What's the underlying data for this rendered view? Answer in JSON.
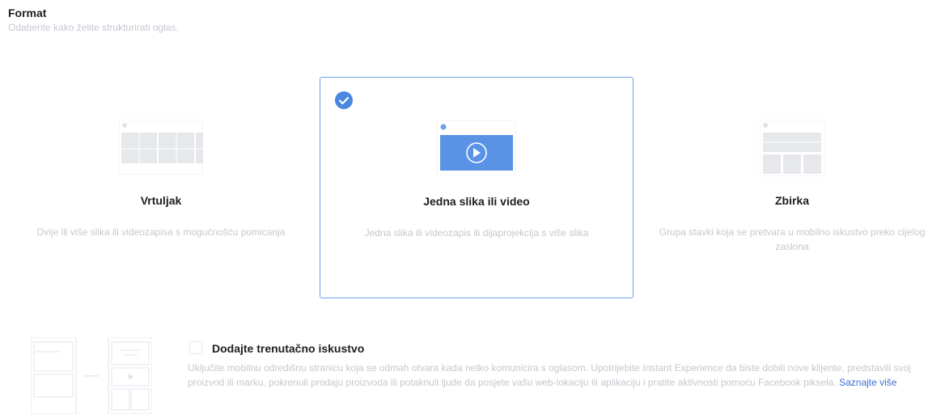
{
  "header": {
    "title": "Format",
    "subtitle": "Odaberite kako želite strukturirati oglas."
  },
  "formats": [
    {
      "name": "Vrtuljak",
      "description": "Dvije ili više slika ili videozapisa s mogućnošću pomicanja",
      "icon": "carousel-icon",
      "selected": false
    },
    {
      "name": "Jedna slika ili video",
      "description": "Jedna slika ili videozapis ili dijaprojekcija s više slika",
      "icon": "single-image-video-icon",
      "selected": true
    },
    {
      "name": "Zbirka",
      "description": "Grupa stavki koja se pretvara u mobilno iskustvo preko cijelog zaslona",
      "icon": "collection-icon",
      "selected": false
    }
  ],
  "instant_experience": {
    "title": "Dodajte trenutačno iskustvo",
    "description": "Uključite mobilnu odredišnu stranicu koja se odmah otvara kada netko komunicira s oglasom. Upotrijebite Instant Experience da biste dobili nove klijente, predstavili svoj proizvod ili marku, pokrenuli prodaju proizvoda ili potaknuli ljude da posjete vašu web-lokaciju ili aplikaciju i pratite aktivnosti pomoću Facebook piksela.",
    "link_label": "Saznajte više",
    "checked": false
  },
  "colors": {
    "accent": "#4a87e0",
    "selected_border": "#6fa0e8",
    "link": "#3b6fd1",
    "muted_text": "#c4c8cf"
  }
}
